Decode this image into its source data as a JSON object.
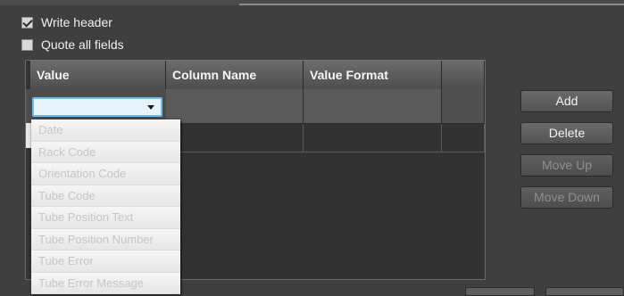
{
  "options": {
    "write_header": {
      "label": "Write header",
      "checked": true
    },
    "quote_all_fields": {
      "label": "Quote all fields",
      "checked": false
    }
  },
  "grid": {
    "columns": [
      "Value",
      "Column Name",
      "Value Format"
    ]
  },
  "dropdown": {
    "items": [
      "Date",
      "Rack Code",
      "Orientation Code",
      "Tube Code",
      "Tube Position Text",
      "Tube Position Number",
      "Tube Error",
      "Tube Error Message"
    ]
  },
  "buttons": {
    "add": "Add",
    "delete": "Delete",
    "move_up": "Move Up",
    "move_down": "Move Down"
  }
}
